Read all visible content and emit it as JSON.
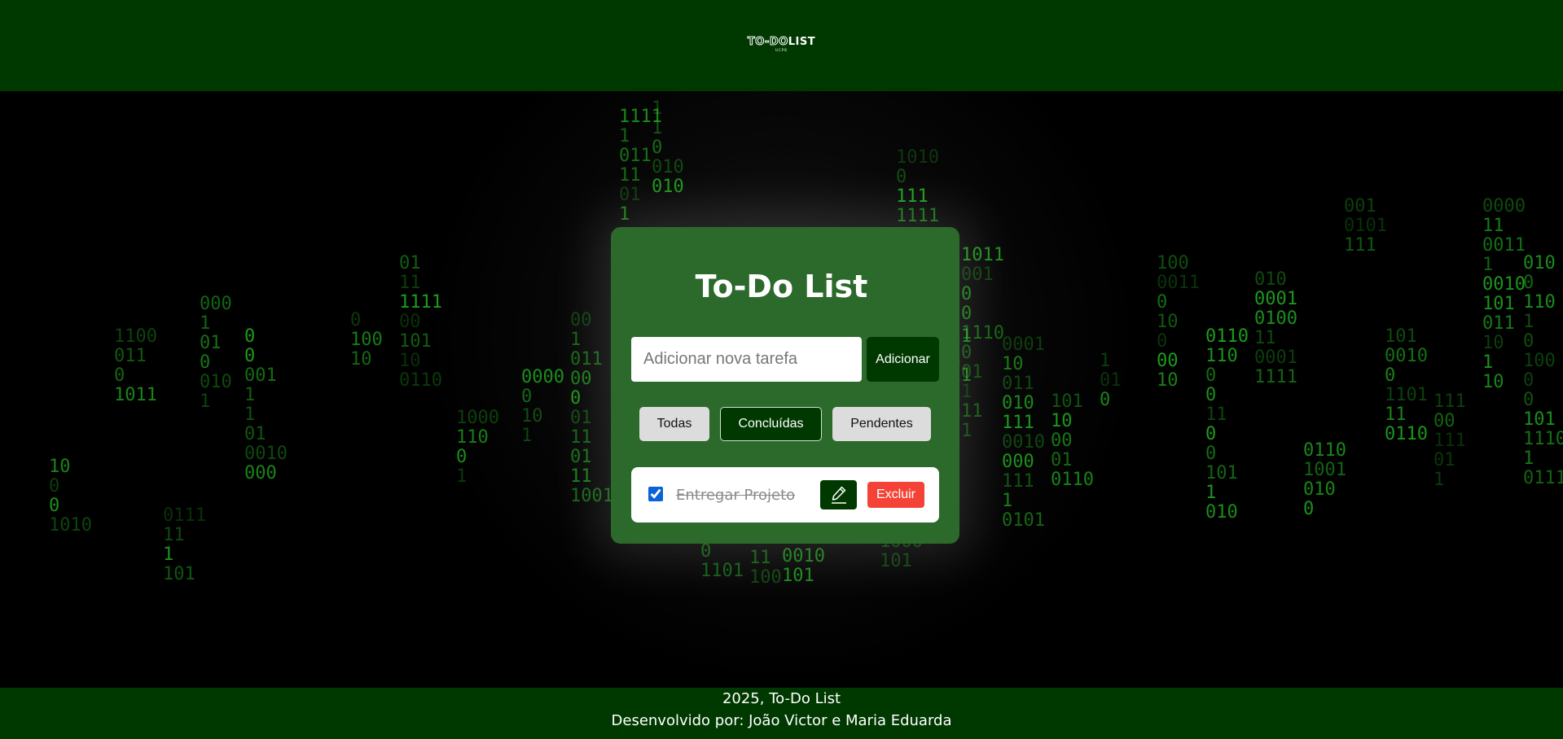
{
  "header": {
    "logo_part1": "TO-DO",
    "logo_part2": "LIST",
    "logo_subtitle": "UCPB"
  },
  "card": {
    "title": "To-Do List",
    "input_placeholder": "Adicionar nova tarefa",
    "input_value": "",
    "add_label": "Adicionar"
  },
  "filters": [
    {
      "label": "Todas",
      "active": false
    },
    {
      "label": "Concluídas",
      "active": true
    },
    {
      "label": "Pendentes",
      "active": false
    }
  ],
  "tasks": [
    {
      "text": "Entregar Projeto",
      "completed": true,
      "edit_icon": "pencil-icon",
      "delete_label": "Excluir"
    }
  ],
  "footer": {
    "line1": "2025, To-Do List",
    "line2": "Desenvolvido por: João Victor e Maria Eduarda"
  },
  "colors": {
    "header_bg": "#003900",
    "card_bg": "#2c6a2c",
    "matrix_text": "#22bb22",
    "delete_button": "#f44336"
  }
}
